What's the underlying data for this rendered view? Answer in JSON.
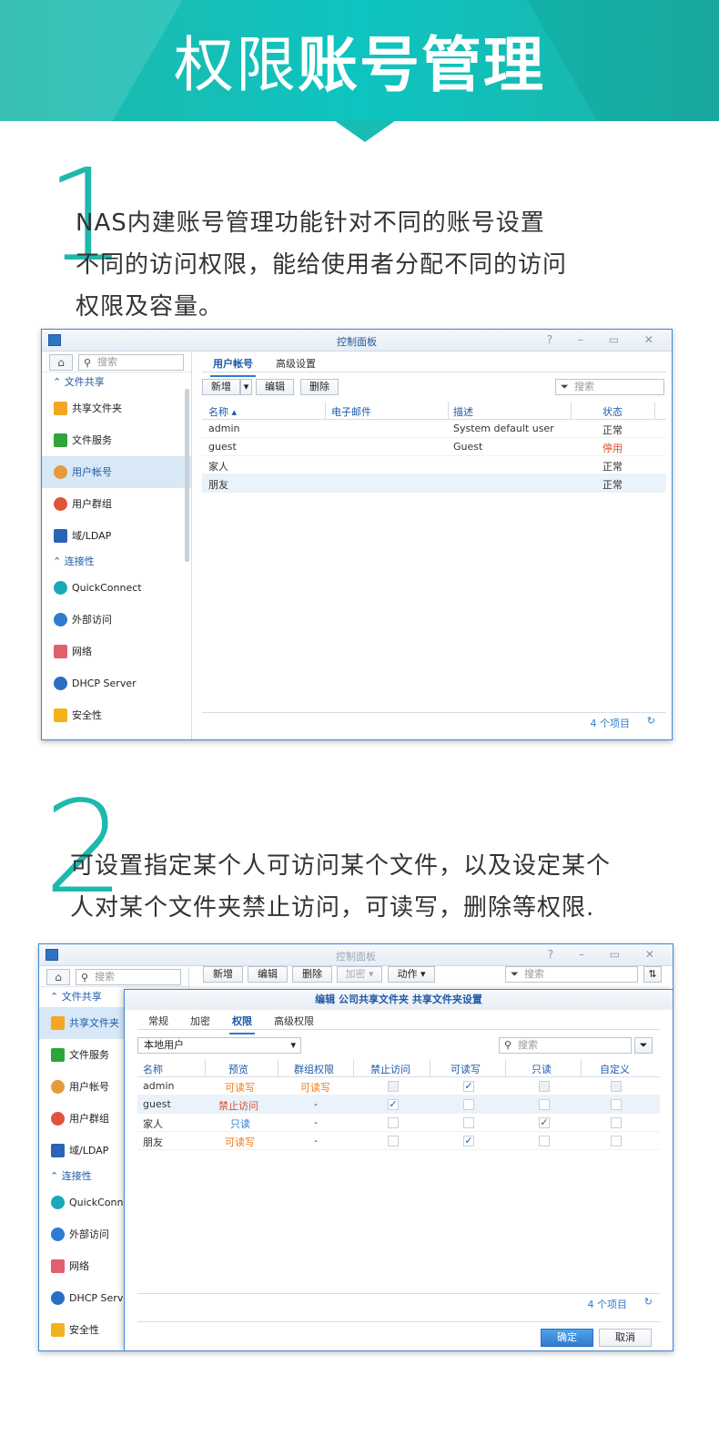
{
  "banner": {
    "title_light": "权限",
    "title_bold": "账号管理"
  },
  "section1": {
    "number": "1",
    "lines": [
      "NAS内建账号管理功能针对不同的账号设置",
      "不同的访问权限，能给使用者分配不同的访问",
      "权限及容量。"
    ]
  },
  "section2": {
    "number": "2",
    "lines": [
      "可设置指定某个人可访问某个文件，以及设定某个",
      "人对某个文件夹禁止访问，可读写，删除等权限."
    ]
  },
  "colors": {
    "accent": "#1fb8ad",
    "window_border": "#3f86d2",
    "disabled": "#e04a2a",
    "read_write": "#f07814"
  },
  "win1": {
    "title": "控制面板",
    "controls": "?  –  ▭  ✕",
    "search_placeholder": "搜索",
    "sidebar": {
      "sec_share": "文件共享",
      "sec_conn": "连接性",
      "items": [
        {
          "label": "共享文件夹",
          "icon": "folder-share-icon",
          "color": "#f5a623"
        },
        {
          "label": "文件服务",
          "icon": "file-services-icon",
          "color": "#2ea43a"
        },
        {
          "label": "用户帐号",
          "icon": "user-icon",
          "color": "#e59b3c"
        },
        {
          "label": "用户群组",
          "icon": "group-icon",
          "color": "#e0543b"
        },
        {
          "label": "域/LDAP",
          "icon": "ldap-icon",
          "color": "#2b63b5"
        },
        {
          "label": "QuickConnect",
          "icon": "quickconnect-icon",
          "color": "#1aa9b8"
        },
        {
          "label": "外部访问",
          "icon": "globe-icon",
          "color": "#2f7bd0"
        },
        {
          "label": "网络",
          "icon": "network-home-icon",
          "color": "#e06070"
        },
        {
          "label": "DHCP Server",
          "icon": "dhcp-icon",
          "color": "#2b6fc0"
        },
        {
          "label": "安全性",
          "icon": "shield-icon",
          "color": "#f2b21b"
        }
      ]
    },
    "tabs": [
      "用户帐号",
      "高级设置"
    ],
    "toolbar": {
      "new": "新增",
      "dropdown": "▾",
      "edit": "编辑",
      "delete": "删除",
      "filter_placeholder": "搜索"
    },
    "columns": [
      "名称 ▴",
      "电子邮件",
      "描述",
      "状态"
    ],
    "rows": [
      {
        "name": "admin",
        "email": "",
        "desc": "System default user",
        "status": "正常"
      },
      {
        "name": "guest",
        "email": "",
        "desc": "Guest",
        "status": "停用"
      },
      {
        "name": "家人",
        "email": "",
        "desc": "",
        "status": "正常"
      },
      {
        "name": "朋友",
        "email": "",
        "desc": "",
        "status": "正常"
      }
    ],
    "footer": {
      "count": "4 个项目",
      "refresh": "↻"
    }
  },
  "win2": {
    "title": "控制面板",
    "controls": "?  –  ▭  ✕",
    "search_placeholder": "搜索",
    "sidebar_items": [
      "共享文件夹",
      "文件服务",
      "用户帐号",
      "用户群组",
      "域/LDAP",
      "QuickConnect",
      "外部访问",
      "网络",
      "DHCP Server",
      "安全性"
    ],
    "sec_share": "文件共享",
    "sec_conn": "连接性",
    "toolbar": {
      "new": "新增",
      "edit": "编辑",
      "delete": "删除",
      "encrypt": "加密 ▾",
      "action": "动作 ▾",
      "filter_placeholder": "搜索",
      "sort": "⇅"
    },
    "dialog": {
      "title": "编辑 公司共享文件夹 共享文件夹设置",
      "tabs": [
        "常规",
        "加密",
        "权限",
        "高级权限"
      ],
      "select_value": "本地用户",
      "search_placeholder": "搜索",
      "columns": [
        "名称",
        "预览",
        "群组权限",
        "禁止访问",
        "可读写",
        "只读",
        "自定义"
      ],
      "rows": [
        {
          "name": "admin",
          "preview": "可读写",
          "group": "可读写",
          "deny": false,
          "rw": true,
          "ro": false,
          "custom": false
        },
        {
          "name": "guest",
          "preview": "禁止访问",
          "group": "-",
          "deny": true,
          "rw": false,
          "ro": false,
          "custom": false
        },
        {
          "name": "家人",
          "preview": "只读",
          "group": "-",
          "deny": false,
          "rw": false,
          "ro": true,
          "custom": false
        },
        {
          "name": "朋友",
          "preview": "可读写",
          "group": "-",
          "deny": false,
          "rw": true,
          "ro": false,
          "custom": false
        }
      ],
      "footer_count": "4 个项目",
      "ok": "确定",
      "cancel": "取消"
    }
  }
}
